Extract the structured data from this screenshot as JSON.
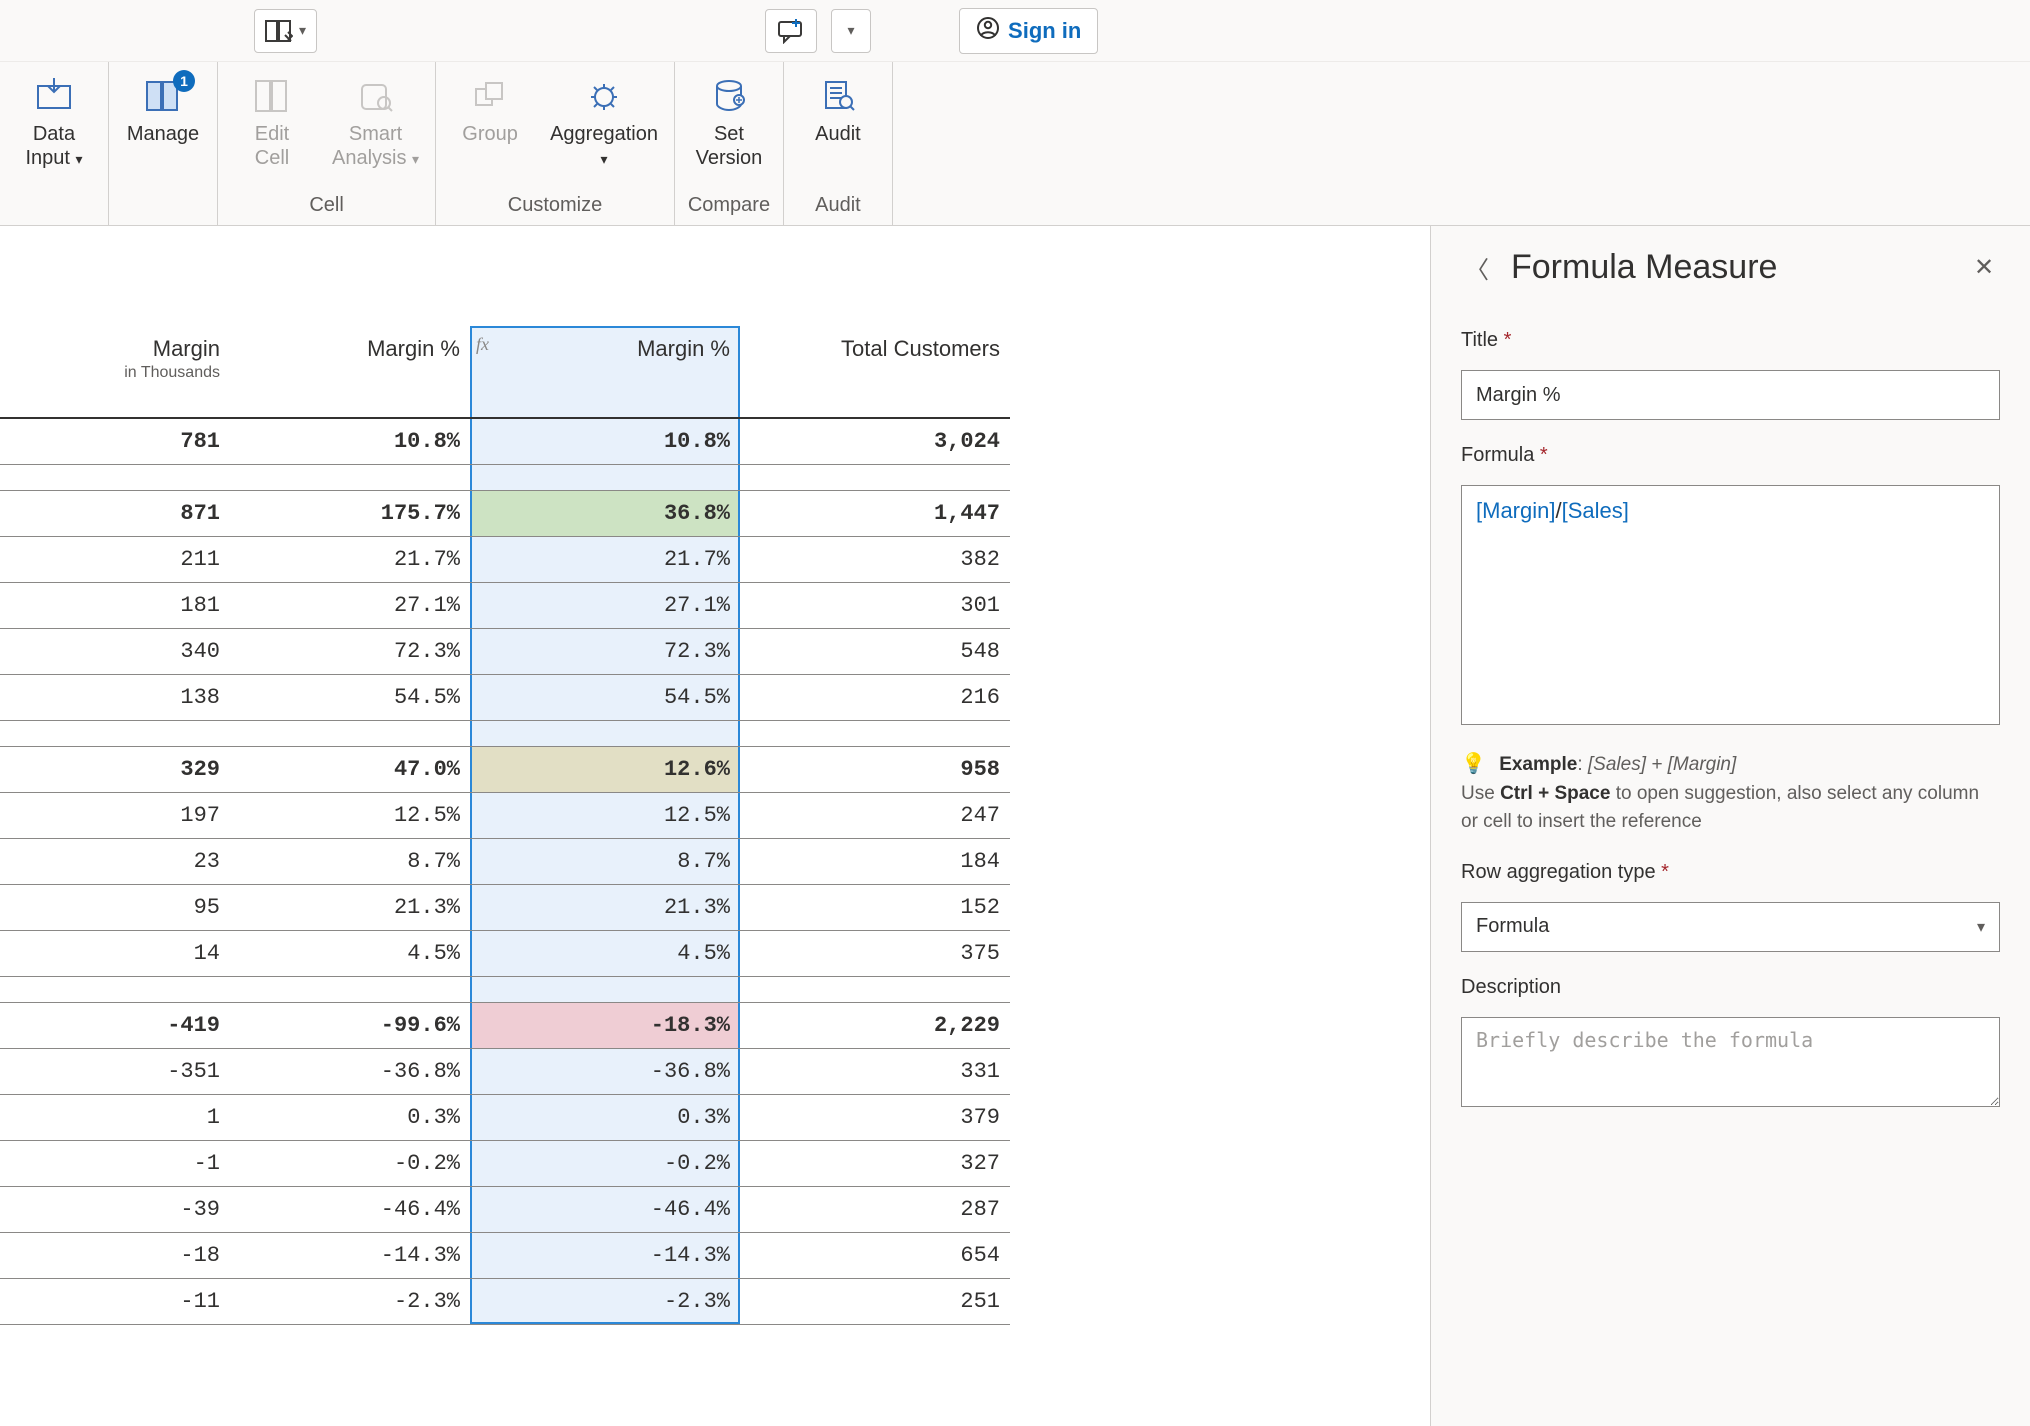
{
  "ribbon_top": {
    "signin_label": "Sign in"
  },
  "ribbon": {
    "data_input": "Data\nInput",
    "manage": "Manage",
    "manage_badge": "1",
    "edit_cell": "Edit\nCell",
    "smart_analysis": "Smart\nAnalysis",
    "group": "Group",
    "aggregation": "Aggregation",
    "set_version": "Set\nVersion",
    "audit": "Audit",
    "grp_cell": "Cell",
    "grp_customize": "Customize",
    "grp_compare": "Compare",
    "grp_audit": "Audit"
  },
  "columns": {
    "c1_title": "Margin",
    "c1_sub": "in Thousands",
    "c2_title": "Margin %",
    "c3_title": "Margin %",
    "c3_fx": "fx",
    "c4_title": "Total Customers"
  },
  "rows": [
    {
      "type": "bold",
      "c1": "781",
      "c2": "10.8%",
      "c3": "10.8%",
      "c4": "3,024"
    },
    {
      "type": "spacer"
    },
    {
      "type": "green bold",
      "c1": "871",
      "c2": "175.7%",
      "c3": "36.8%",
      "c4": "1,447"
    },
    {
      "type": "",
      "c1": "211",
      "c2": "21.7%",
      "c3": "21.7%",
      "c4": "382"
    },
    {
      "type": "",
      "c1": "181",
      "c2": "27.1%",
      "c3": "27.1%",
      "c4": "301"
    },
    {
      "type": "",
      "c1": "340",
      "c2": "72.3%",
      "c3": "72.3%",
      "c4": "548"
    },
    {
      "type": "",
      "c1": "138",
      "c2": "54.5%",
      "c3": "54.5%",
      "c4": "216"
    },
    {
      "type": "spacer-thin"
    },
    {
      "type": "yellow bold",
      "c1": "329",
      "c2": "47.0%",
      "c3": "12.6%",
      "c4": "958"
    },
    {
      "type": "",
      "c1": "197",
      "c2": "12.5%",
      "c3": "12.5%",
      "c4": "247"
    },
    {
      "type": "",
      "c1": "23",
      "c2": "8.7%",
      "c3": "8.7%",
      "c4": "184"
    },
    {
      "type": "",
      "c1": "95",
      "c2": "21.3%",
      "c3": "21.3%",
      "c4": "152"
    },
    {
      "type": "",
      "c1": "14",
      "c2": "4.5%",
      "c3": "4.5%",
      "c4": "375"
    },
    {
      "type": "spacer-thin"
    },
    {
      "type": "pink bold",
      "c1": "-419",
      "c2": "-99.6%",
      "c3": "-18.3%",
      "c4": "2,229"
    },
    {
      "type": "",
      "c1": "-351",
      "c2": "-36.8%",
      "c3": "-36.8%",
      "c4": "331"
    },
    {
      "type": "",
      "c1": "1",
      "c2": "0.3%",
      "c3": "0.3%",
      "c4": "379"
    },
    {
      "type": "",
      "c1": "-1",
      "c2": "-0.2%",
      "c3": "-0.2%",
      "c4": "327"
    },
    {
      "type": "",
      "c1": "-39",
      "c2": "-46.4%",
      "c3": "-46.4%",
      "c4": "287"
    },
    {
      "type": "",
      "c1": "-18",
      "c2": "-14.3%",
      "c3": "-14.3%",
      "c4": "654"
    },
    {
      "type": "last-row",
      "c1": "-11",
      "c2": "-2.3%",
      "c3": "-2.3%",
      "c4": "251"
    }
  ],
  "panel": {
    "title": "Formula Measure",
    "label_title": "Title",
    "title_value": "Margin %",
    "label_formula": "Formula",
    "formula_tokens": [
      {
        "t": "[Margin]",
        "c": "blue"
      },
      {
        "t": "/",
        "c": "plain"
      },
      {
        "t": "[Sales]",
        "c": "blue"
      }
    ],
    "hint_example_label": "Example",
    "hint_example_value": "[Sales] + [Margin]",
    "hint_line2a": "Use ",
    "hint_ctrl_space": "Ctrl + Space",
    "hint_line2b": " to open suggestion, also select any column or cell to insert the reference",
    "label_agg": "Row aggregation type",
    "agg_value": "Formula",
    "label_desc": "Description",
    "desc_placeholder": "Briefly describe the formula"
  }
}
